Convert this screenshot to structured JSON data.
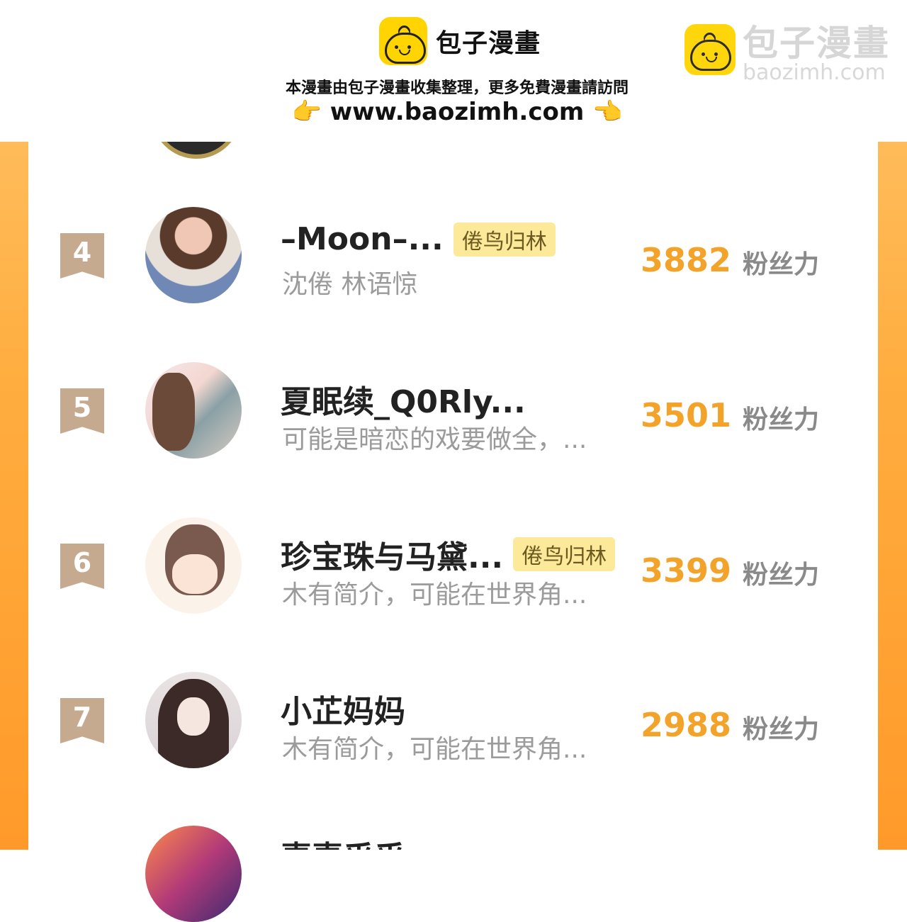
{
  "banner": {
    "brand": "包子漫畫",
    "notice": "本漫畫由包子漫畫收集整理，更多免費漫畫請訪問",
    "url": "www.baozimh.com",
    "watermark_name": "包子漫畫",
    "watermark_url": "baozimh.com"
  },
  "list": [
    {
      "rank": "4",
      "name": "–Moon–...",
      "tag": "倦鸟归林",
      "bio": "沈倦 林语惊",
      "score": "3882",
      "unit": "粉丝力"
    },
    {
      "rank": "5",
      "name": "夏眠续_Q0Rly...",
      "tag": "",
      "bio": "可能是暗恋的戏要做全，...",
      "score": "3501",
      "unit": "粉丝力"
    },
    {
      "rank": "6",
      "name": "珍宝珠与马黛...",
      "tag": "倦鸟归林",
      "bio": "木有简介，可能在世界角...",
      "score": "3399",
      "unit": "粉丝力"
    },
    {
      "rank": "7",
      "name": "小芷妈妈",
      "tag": "",
      "bio": "木有简介，可能在世界角...",
      "score": "2988",
      "unit": "粉丝力"
    }
  ],
  "partial_next_name": "喜喜乎乎",
  "colors": {
    "accent": "#f3a32a",
    "frame": "#ffad3f",
    "rank_badge": "#c6aa8f",
    "tag_bg": "#fde99a"
  }
}
